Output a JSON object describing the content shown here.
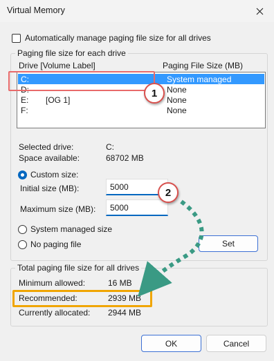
{
  "window": {
    "title": "Virtual Memory"
  },
  "auto_manage": {
    "label": "Automatically manage paging file size for all drives",
    "checked": false
  },
  "paging_group": {
    "title": "Paging file size for each drive",
    "col_drive": "Drive  [Volume Label]",
    "col_size": "Paging File Size (MB)",
    "drives": [
      {
        "letter": "C:",
        "label": "",
        "size": "System managed",
        "selected": true
      },
      {
        "letter": "D:",
        "label": "",
        "size": "None",
        "selected": false
      },
      {
        "letter": "E:",
        "label": "[OG 1]",
        "size": "None",
        "selected": false
      },
      {
        "letter": "F:",
        "label": "",
        "size": "None",
        "selected": false
      }
    ],
    "selected_drive_label": "Selected drive:",
    "selected_drive_value": "C:",
    "space_label": "Space available:",
    "space_value": "68702 MB",
    "custom_size_label": "Custom size:",
    "initial_label": "Initial size (MB):",
    "initial_value": "5000",
    "max_label": "Maximum size (MB):",
    "max_value": "5000",
    "system_managed_label": "System managed size",
    "no_paging_label": "No paging file",
    "set_label": "Set"
  },
  "totals_group": {
    "title": "Total paging file size for all drives",
    "min_label": "Minimum allowed:",
    "min_value": "16 MB",
    "rec_label": "Recommended:",
    "rec_value": "2939 MB",
    "cur_label": "Currently allocated:",
    "cur_value": "2944 MB"
  },
  "footer": {
    "ok_label": "OK",
    "cancel_label": "Cancel"
  },
  "annotations": {
    "badge_1": "1",
    "badge_2": "2",
    "red": "#e86a6a",
    "gold": "#f0a500",
    "teal": "#3a9a84"
  },
  "colors": {
    "accent": "#0067c0",
    "selection": "#3399ff"
  }
}
